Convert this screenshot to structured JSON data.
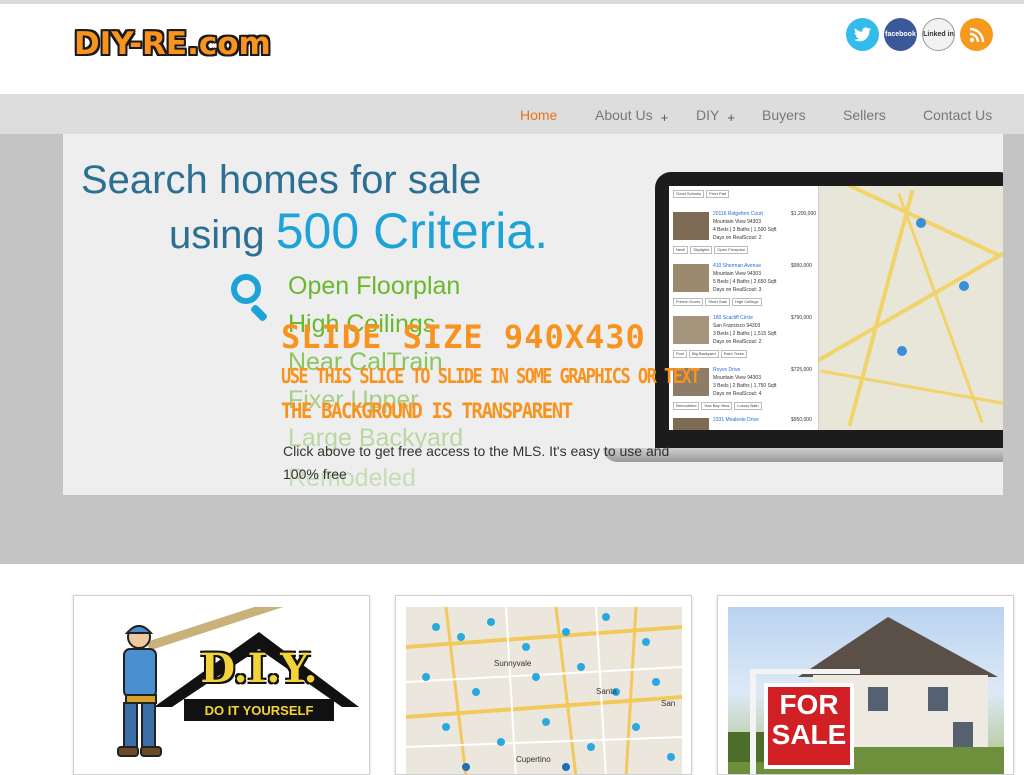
{
  "header": {
    "logo": "DIY-RE.com",
    "social": [
      {
        "icon": "twitter-icon",
        "label": "t",
        "color": "#33bbec"
      },
      {
        "icon": "facebook-icon",
        "label": "facebook",
        "color": "#3b5998"
      },
      {
        "icon": "linkedin-icon",
        "label": "Linked in",
        "color": "#f2f2f2"
      },
      {
        "icon": "rss-icon",
        "label": "rss",
        "color": "#f59a1e"
      }
    ]
  },
  "nav": {
    "items": [
      {
        "label": "Home",
        "active": true
      },
      {
        "label": "About Us",
        "has_submenu": true
      },
      {
        "label": "DIY",
        "has_submenu": true
      },
      {
        "label": "Buyers"
      },
      {
        "label": "Sellers"
      },
      {
        "label": "Contact Us"
      }
    ],
    "plus": "+"
  },
  "slide": {
    "headline_line1": "Search homes for sale",
    "headline_line2_prefix": "using ",
    "headline_line2_big": "500 Criteria.",
    "criteria": [
      "Open Floorplan",
      "High Ceilings",
      "Near CalTrain",
      "Fixer Upper",
      "Large Backyard",
      "Remodeled"
    ],
    "overlay_title": "SLIDE SIZE 940X430",
    "overlay_line1": "USE THIS SLICE TO SLIDE IN SOME GRAPHICS OR TEXT",
    "overlay_line2": "THE BACKGROUND IS TRANSPARENT",
    "caption": "Click above to get free access to the MLS. It's easy to use and 100% free",
    "listings": [
      {
        "title": "Good Schools",
        "tags": [
          "Good Schools",
          "Fixer Pad"
        ],
        "is_tagrow_only": true
      },
      {
        "title": "20116 Ridgefom Court",
        "city": "Mountain View 94303",
        "specs": "4 Beds | 3 Baths | 1,500 Sqft",
        "days": "Days on RealScout: 2",
        "price": "$1,200,000",
        "tags": [
          "Next!",
          "Skylights",
          "Open Floorplan"
        ]
      },
      {
        "title": "410 Sherman Avenue",
        "city": "Mountain View 94303",
        "specs": "5 Beds | 4 Baths | 2,650 Sqft",
        "days": "Days on RealScout: 3",
        "price": "$950,000",
        "tags": [
          "French Doors",
          "Short Sale",
          "High Ceilings"
        ]
      },
      {
        "title": "180 Scacliff Circle",
        "city": "San Francisco 94303",
        "specs": "3 Beds | 2 Baths | 1,515 Sqft",
        "days": "Days on RealScout: 2",
        "price": "$790,000",
        "tags": [
          "Pool",
          "Big Backyard",
          "Palm Trees"
        ]
      },
      {
        "title": "Royce Drive",
        "city": "Mountain View 94303",
        "specs": "3 Beds | 2 Baths | 1,750 Sqft",
        "days": "Days on RealScout: 4",
        "price": "$725,000",
        "tags": [
          "Remodeled",
          "Has Bay View",
          "Luxury Bath"
        ]
      },
      {
        "title": "2331 Miraleste Drive",
        "city": "Mountain View 94303",
        "specs": "",
        "days": "",
        "price": "$950,000",
        "tags": []
      }
    ]
  },
  "cards": [
    {
      "name": "diy-card",
      "badge_text": "D.I.Y.",
      "ribbon_text": "DO IT YOURSELF"
    },
    {
      "name": "map-card",
      "labels": [
        "Sunnyvale",
        "Santa",
        "Cupertino",
        "San"
      ]
    },
    {
      "name": "for-sale-card",
      "sign_line1": "FOR",
      "sign_line2": "SALE"
    }
  ],
  "colors": {
    "accent_orange": "#f7931e",
    "nav_active": "#e8731c",
    "headline_blue": "#2b6f93",
    "bright_blue": "#1ea3d8",
    "criteria_green": "#6ab82c",
    "sale_red": "#d11f26"
  }
}
